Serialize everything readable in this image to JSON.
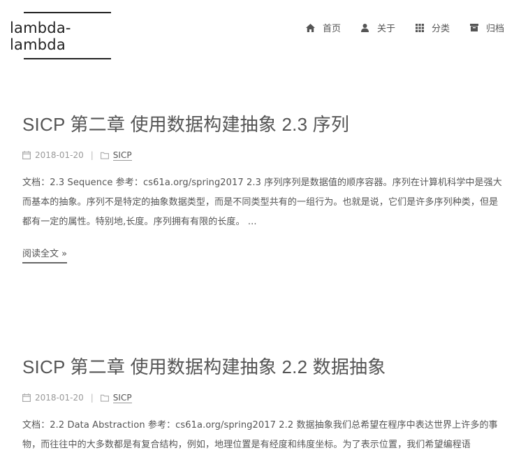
{
  "site": {
    "name": "lambda-lambda"
  },
  "nav": [
    {
      "label": "首页",
      "icon": "home-icon"
    },
    {
      "label": "关于",
      "icon": "user-icon"
    },
    {
      "label": "分类",
      "icon": "grid-icon"
    },
    {
      "label": "归档",
      "icon": "archive-icon"
    }
  ],
  "posts": [
    {
      "title": "SICP 第二章 使用数据构建抽象 2.3 序列",
      "date": "2018-01-20",
      "separator": "|",
      "category": "SICP",
      "excerpt": "文档：2.3 Sequence 参考：cs61a.org/spring2017 2.3 序列序列是数据值的顺序容器。序列在计算机科学中是强大而基本的抽象。序列不是特定的抽象数据类型，而是不同类型共有的一组行为。也就是说，它们是许多序列种类，但是都有一定的属性。特别地,长度。序列拥有有限的长度。 ...",
      "read_more": "阅读全文 »"
    },
    {
      "title": "SICP 第二章 使用数据构建抽象 2.2 数据抽象",
      "date": "2018-01-20",
      "separator": "|",
      "category": "SICP",
      "excerpt": "文档：2.2 Data Abstraction 参考：cs61a.org/spring2017 2.2 数据抽象我们总希望在程序中表达世界上许多的事物，而往往中的大多数都是有复合结构，例如，地理位置是有经度和纬度坐标。为了表示位置，我们希望编程语"
    }
  ]
}
